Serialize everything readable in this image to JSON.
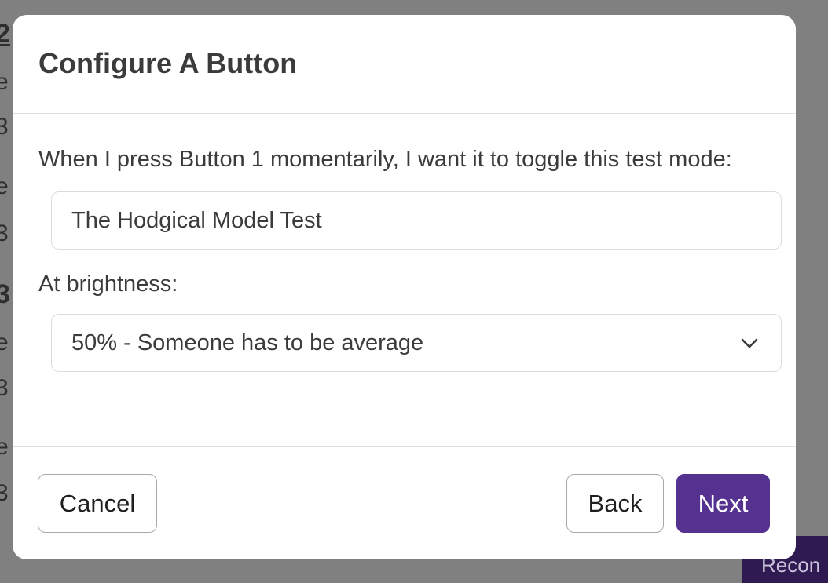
{
  "background": {
    "fragments": [
      "2",
      "e",
      "3",
      "e",
      "3",
      "3",
      "e",
      "3",
      "e",
      "3"
    ],
    "action_button_label": "Recon"
  },
  "modal": {
    "title": "Configure A Button",
    "prompt": "When I press Button 1 momentarily, I want it to toggle this test mode:",
    "test_mode_value": "The Hodgical Model Test",
    "brightness_label": "At brightness:",
    "brightness_selected": "50% - Someone has to be average",
    "buttons": {
      "cancel": "Cancel",
      "back": "Back",
      "next": "Next"
    }
  },
  "colors": {
    "primary": "#563290",
    "overlay": "#808080"
  },
  "icons": {
    "select_chevron": "chevron-down-icon"
  }
}
